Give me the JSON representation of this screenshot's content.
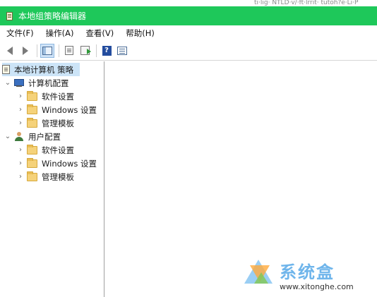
{
  "background_text": "ti·lig· NTLD·v/·ft·lrrit· tutoh?e·Li·P",
  "window": {
    "title": "本地组策略编辑器",
    "titlebar_color": "#1ec85a"
  },
  "menu": {
    "items": [
      {
        "label": "文件(F)"
      },
      {
        "label": "操作(A)"
      },
      {
        "label": "查看(V)"
      },
      {
        "label": "帮助(H)"
      }
    ]
  },
  "toolbar": {
    "buttons": [
      {
        "icon": "back-arrow-icon"
      },
      {
        "icon": "forward-arrow-icon"
      },
      {
        "icon": "show-hide-console-tree-icon"
      },
      {
        "icon": "properties-page-icon"
      },
      {
        "icon": "export-list-icon"
      },
      {
        "icon": "help-icon",
        "glyph": "?"
      },
      {
        "icon": "show-hide-action-pane-icon"
      }
    ]
  },
  "tree": {
    "root": {
      "label": "本地计算机 策略"
    },
    "computer_config": {
      "label": "计算机配置",
      "children": [
        {
          "label": "软件设置"
        },
        {
          "label": "Windows 设置"
        },
        {
          "label": "管理模板"
        }
      ]
    },
    "user_config": {
      "label": "用户配置",
      "children": [
        {
          "label": "软件设置"
        },
        {
          "label": "Windows 设置"
        },
        {
          "label": "管理模板"
        }
      ]
    }
  },
  "watermark": {
    "name": "系统盒",
    "url": "www.xitonghe.com"
  }
}
